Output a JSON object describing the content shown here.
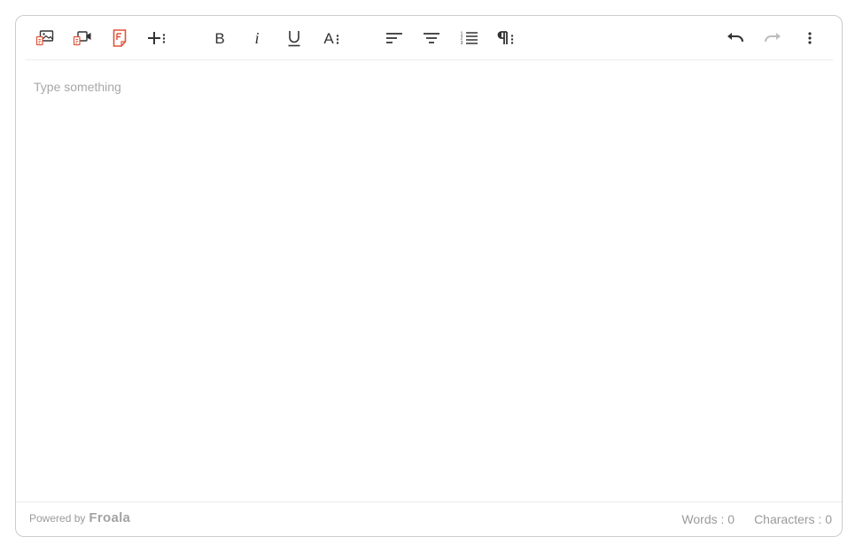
{
  "toolbar": {
    "buttons": [
      {
        "name": "insert-image-icon"
      },
      {
        "name": "insert-video-icon"
      },
      {
        "name": "insert-file-icon"
      },
      {
        "name": "more-rich-icon"
      },
      {
        "name": "bold-icon"
      },
      {
        "name": "italic-icon"
      },
      {
        "name": "underline-icon"
      },
      {
        "name": "more-text-icon"
      },
      {
        "name": "align-left-icon"
      },
      {
        "name": "align-center-icon"
      },
      {
        "name": "ordered-list-icon"
      },
      {
        "name": "more-paragraph-icon"
      },
      {
        "name": "undo-icon"
      },
      {
        "name": "redo-icon"
      },
      {
        "name": "more-misc-icon"
      }
    ],
    "accent_color": "#e0533a",
    "icon_color": "#333333",
    "disabled_color": "#bdbdbd"
  },
  "content": {
    "placeholder": "Type something"
  },
  "footer": {
    "powered_by": "Powered by",
    "brand": "Froala",
    "words": "Words : 0",
    "characters": "Characters : 0"
  }
}
